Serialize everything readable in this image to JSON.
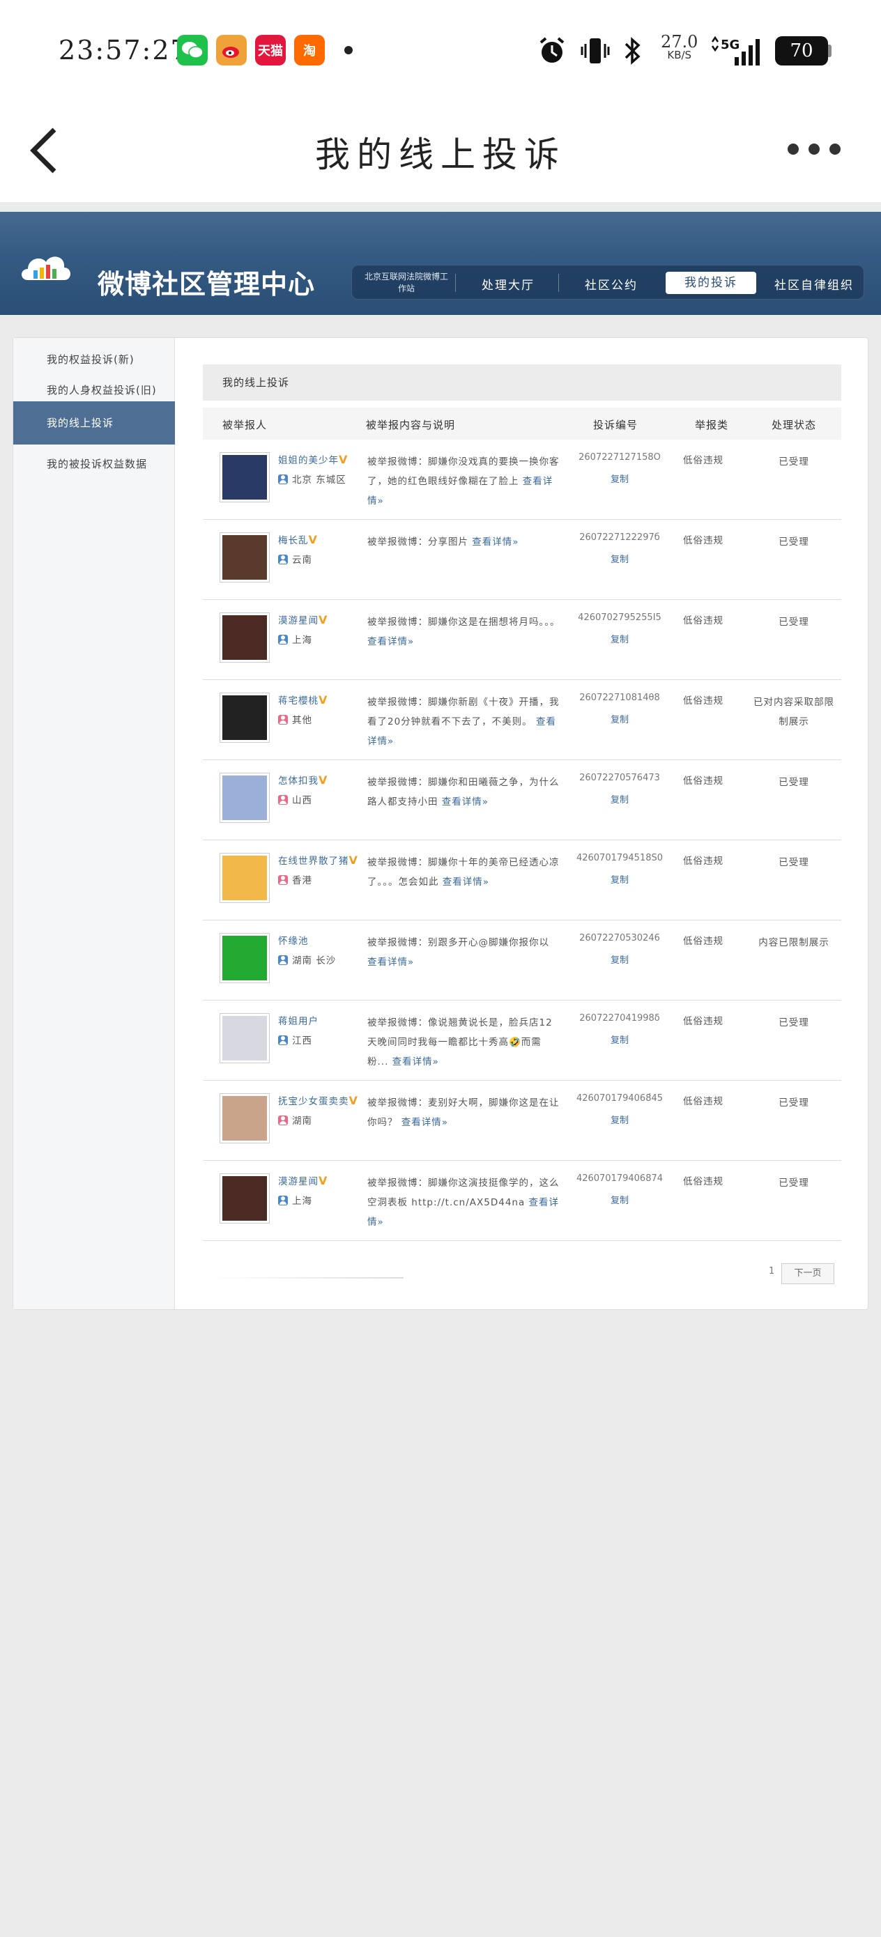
{
  "status_bar": {
    "time": "23:57:27",
    "apps": [
      {
        "name": "wechat",
        "label": "",
        "color": "#1ec24a"
      },
      {
        "name": "weibo",
        "label": "",
        "color": "#f0a23a"
      },
      {
        "name": "tmall",
        "label": "天猫",
        "color": "#e3173d"
      },
      {
        "name": "taobao-special",
        "label": "淘",
        "color": "#ff6a00"
      }
    ],
    "net_speed": "27.0",
    "net_unit": "KB/S",
    "network": "5G",
    "battery": "70"
  },
  "nav": {
    "title": "我的线上投诉"
  },
  "banner": {
    "title": "微博社区管理中心",
    "nav_first": "北京互联网法院微博工作站",
    "nav_items": [
      "处理大厅",
      "社区公约",
      "我的投诉",
      "社区自律组织"
    ],
    "active_index": 2
  },
  "sidebar": {
    "items": [
      "我的权益投诉(新)",
      "我的人身权益投诉(旧)",
      "我的线上投诉",
      "我的被投诉权益数据"
    ],
    "active_index": 2
  },
  "content": {
    "title": "我的线上投诉",
    "columns": [
      "被举报人",
      "被举报内容与说明",
      "投诉编号",
      "举报类",
      "处理状态"
    ],
    "copy_label": "复制",
    "rows": [
      {
        "name": "姐姐的美少年",
        "verified": true,
        "location": "北京 东城区",
        "gender": "male",
        "desc": "被举报微博：脚嫌你没戏真的要换一换你客了，她的红色眼线好像糊在了脸上",
        "more": "查看详情»",
        "id": "2607227127158O",
        "type": "低俗违规",
        "status": "已受理",
        "avatar": "#2a3a66"
      },
      {
        "name": "梅长乱",
        "verified": true,
        "location": "云南",
        "gender": "male",
        "desc": "被举报微博：分享图片",
        "more": "查看详情»",
        "id": "2607227122297б",
        "type": "低俗违规",
        "status": "已受理",
        "avatar": "#5a3a2a"
      },
      {
        "name": "漠游星闻",
        "verified": true,
        "location": "上海",
        "gender": "male",
        "desc": "被举报微博：脚嫌你这是在捆想将月吗。。。",
        "more": "查看详情»",
        "id": "4260702795255I5",
        "type": "低俗违规",
        "status": "已受理",
        "avatar": "#4a2a22"
      },
      {
        "name": "蒋宅櫻桃",
        "verified": true,
        "location": "其他",
        "gender": "female",
        "desc": "被举报微博：脚嫌你新剧《十夜》开播，我看了20分钟就看不下去了，不美则。",
        "more": "查看详情»",
        "id": "260722710814θ8",
        "type": "低俗违规",
        "status": "已对内容采取部限制展示",
        "avatar": "#222222"
      },
      {
        "name": "怎体扣我",
        "verified": true,
        "location": "山西",
        "gender": "female",
        "desc": "被举报微博：脚嫌你和田曦薇之争，为什么路人都支持小田",
        "more": "查看详情»",
        "id": "26072270576473",
        "type": "低俗违规",
        "status": "已受理",
        "avatar": "#9ab0d8"
      },
      {
        "name": "在线世界散了猪",
        "verified": true,
        "location": "香港",
        "gender": "female",
        "desc": "被举报微博：脚嫌你十年的美帝已经透心凉了。。。怎会如此",
        "more": "查看详情»",
        "id": "4260701794518S0",
        "type": "低俗违规",
        "status": "已受理",
        "avatar": "#f2b94a"
      },
      {
        "name": "怀缘池",
        "verified": false,
        "location": "湖南 长沙",
        "gender": "male",
        "desc": "被举报微博：别跟多开心@脚嫌你报你以",
        "more": "查看详情»",
        "id": "26072270530246",
        "type": "低俗违规",
        "status": "内容已限制展示",
        "avatar": "#22aa33"
      },
      {
        "name": "蒋姐用户",
        "verified": false,
        "location": "江西",
        "gender": "male",
        "desc": "被举报微博：像说翘黄说长是，脸兵店12天晚间同时我每一瞻都比十秀高🤣而需粉...",
        "more": "查看详情»",
        "id": "2607227041998δ",
        "type": "低俗违规",
        "status": "已受理",
        "avatar": "#d8d8e0"
      },
      {
        "name": "抚宝少女蛋卖卖",
        "verified": true,
        "location": "湖南",
        "gender": "female",
        "desc": "被举报微博：麦别好大啊，脚嫌你这是在让你吗？",
        "more": "查看详情»",
        "id": "4260701794068́45",
        "type": "低俗违规",
        "status": "已受理",
        "avatar": "#c9a38a"
      },
      {
        "name": "漠游星闻",
        "verified": true,
        "location": "上海",
        "gender": "male",
        "desc": "被举报微博：脚嫌你这演技挺像学的，这么空洞表板 http://t.cn/AX5D44na",
        "more": "查看详情»",
        "id": "426070179406874",
        "type": "低俗违规",
        "status": "已受理",
        "avatar": "#4a2a22"
      }
    ]
  },
  "pager": {
    "page": "1",
    "next_label": "下一页"
  }
}
